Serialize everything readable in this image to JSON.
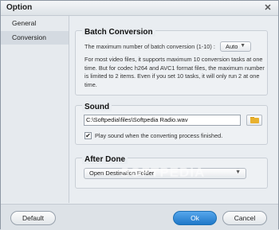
{
  "window": {
    "title": "Option",
    "close_glyph": "✕"
  },
  "sidebar": {
    "items": [
      {
        "label": "General"
      },
      {
        "label": "Conversion"
      }
    ]
  },
  "batch": {
    "title": "Batch Conversion",
    "max_label": "The maximum number of batch conversion (1-10) :",
    "max_value": "Auto",
    "desc_lines": [
      "For most video files, it supports maximum 10 conversion tasks at one",
      "time. But for codec h264 and AVC1 format files, the maximum number",
      "is limited to 2 items. Even if you set 10 tasks, it will only run 2 at one",
      "time."
    ]
  },
  "sound": {
    "title": "Sound",
    "path": "C:\\Softpedia\\files\\Softpedia Radio.wav",
    "check_label": "Play sound when the converting process finished.",
    "checked": true,
    "check_glyph": "✔"
  },
  "after": {
    "title": "After Done",
    "selected": "Open Destination Folder"
  },
  "watermark": "SOFTPEDIA",
  "buttons": {
    "default": "Default",
    "ok": "Ok",
    "cancel": "Cancel"
  },
  "colors": {
    "accent": "#1f78c8",
    "nav_selected": "#d4dae1",
    "folder": "#e8b12f"
  },
  "icons": {
    "close": "close-icon",
    "dropdown": "chevron-down-icon",
    "folder": "folder-icon",
    "check": "checkmark-icon"
  }
}
